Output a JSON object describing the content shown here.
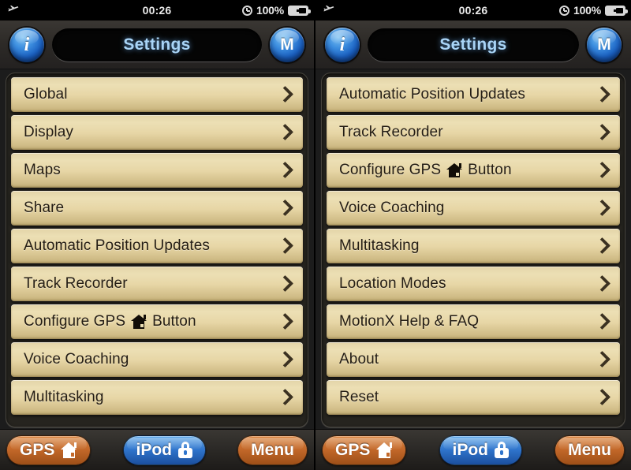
{
  "statusbar": {
    "airplane_icon": "airplane-mode-icon",
    "time": "00:26",
    "alarm_icon": "alarm-clock-icon",
    "battery_percent": "100%",
    "battery_icon": "battery-charging-icon"
  },
  "navbar": {
    "info_button_label": "i",
    "title": "Settings",
    "menu_button_label": "M"
  },
  "panels": [
    {
      "id": "settings-page-1",
      "rows": [
        {
          "label": "Global",
          "icon": null
        },
        {
          "label": "Display",
          "icon": null
        },
        {
          "label": "Maps",
          "icon": null
        },
        {
          "label": "Share",
          "icon": null
        },
        {
          "label": "Automatic Position Updates",
          "icon": null
        },
        {
          "label": "Track Recorder",
          "icon": null
        },
        {
          "label_before": "Configure GPS",
          "icon": "house-icon",
          "label_after": "Button"
        },
        {
          "label": "Voice Coaching",
          "icon": null
        },
        {
          "label": "Multitasking",
          "icon": null
        }
      ]
    },
    {
      "id": "settings-page-2",
      "rows": [
        {
          "label": "Automatic Position Updates",
          "icon": null
        },
        {
          "label": "Track Recorder",
          "icon": null
        },
        {
          "label_before": "Configure GPS",
          "icon": "house-icon",
          "label_after": "Button"
        },
        {
          "label": "Voice Coaching",
          "icon": null
        },
        {
          "label": "Multitasking",
          "icon": null
        },
        {
          "label": "Location Modes",
          "icon": null
        },
        {
          "label": "MotionX Help & FAQ",
          "icon": null
        },
        {
          "label": "About",
          "icon": null
        },
        {
          "label": "Reset",
          "icon": null
        }
      ]
    }
  ],
  "toolbar": {
    "gps_label": "GPS",
    "gps_icon": "house-icon",
    "ipod_label": "iPod",
    "ipod_icon": "lock-icon",
    "menu_label": "Menu"
  },
  "colors": {
    "row_face": "#e7d6a6",
    "row_text": "#241d14",
    "title_text": "#a9d4f6",
    "orange_button": "#c4692a",
    "blue_button": "#2f74cc",
    "chrome": "#2e2b28"
  }
}
